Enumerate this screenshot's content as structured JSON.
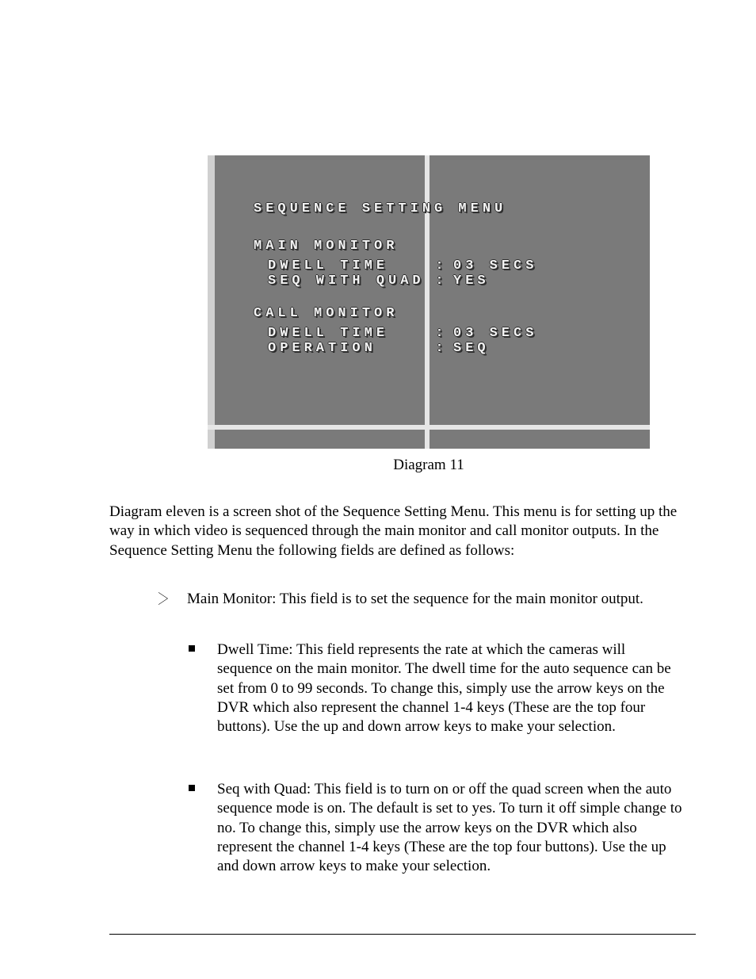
{
  "osd": {
    "title": "SEQUENCE SETTING MENU",
    "main_section": "MAIN MONITOR",
    "main_rows": [
      {
        "label": "DWELL TIME",
        "value": "03 SECS"
      },
      {
        "label": "SEQ WITH QUAD",
        "value": "YES"
      }
    ],
    "call_section": "CALL MONITOR",
    "call_rows": [
      {
        "label": "DWELL TIME",
        "value": "03 SECS"
      },
      {
        "label": "OPERATION",
        "value": "SEQ"
      }
    ]
  },
  "caption": "Diagram 11",
  "para1": "Diagram eleven is a screen shot of the Sequence Setting Menu. This menu is for setting up the way in which video is sequenced through the main monitor and call monitor outputs. In the Sequence Setting Menu the following fields are defined as follows:",
  "l1_main": "Main Monitor: This field is to set the sequence for the main monitor output.",
  "l2_dwell": "Dwell Time: This field represents the rate at which the cameras will sequence on the main monitor. The dwell time for the auto sequence can be set from 0 to 99 seconds. To change this, simply use the arrow keys on the DVR which also represent the channel 1-4 keys (These are the top four buttons). Use the up and down arrow keys to make your selection.",
  "l2_quad": "Seq with Quad: This field is to turn on or off the quad screen when the auto sequence mode is on. The default is set to yes. To turn it off simple change to no. To change this, simply use the arrow keys on the DVR which also represent the channel 1-4 keys (These are the top four buttons). Use the up and down arrow keys to make your selection."
}
